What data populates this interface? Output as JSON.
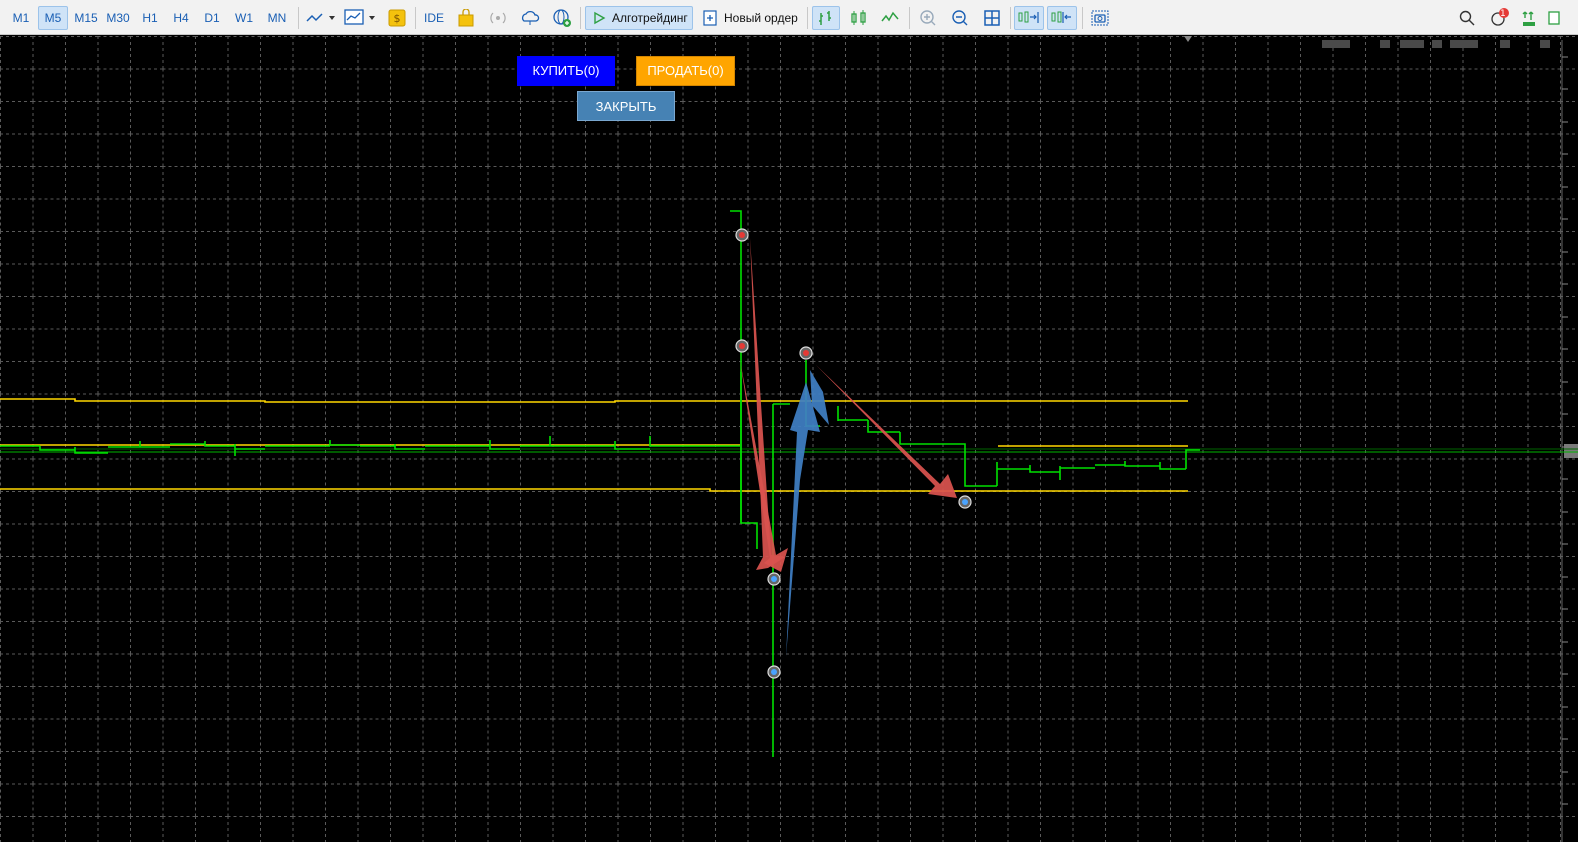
{
  "toolbar": {
    "timeframes": [
      "M1",
      "M5",
      "M15",
      "M30",
      "H1",
      "H4",
      "D1",
      "W1",
      "MN"
    ],
    "active_timeframe": "M5",
    "ide_label": "IDE",
    "algotrading_label": "Алготрейдинг",
    "new_order_label": "Новый ордер",
    "notification_count": "1"
  },
  "trade_panel": {
    "buy_label": "КУПИТЬ(0)",
    "sell_label": "ПРОДАТЬ(0)",
    "close_label": "ЗАКРЫТЬ"
  },
  "colors": {
    "chart_background": "#000000",
    "price_line": "#00e000",
    "band_line": "#ffd700",
    "buy_button": "#0000ff",
    "sell_button": "#ffa500",
    "close_button": "#4682b4",
    "arrow_sell": "#d9534f",
    "arrow_buy": "#3f7fc4"
  }
}
